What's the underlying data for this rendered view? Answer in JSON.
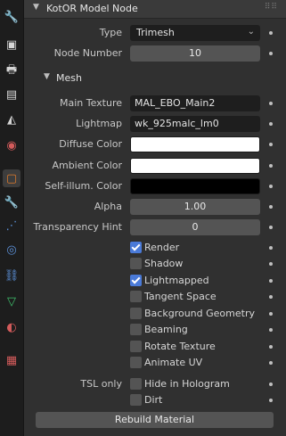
{
  "tabs": [
    {
      "icon": "tool-icon",
      "glyph": "🔧"
    },
    {
      "icon": "render-icon",
      "glyph": "▣"
    },
    {
      "icon": "output-icon",
      "glyph": "🖶"
    },
    {
      "icon": "view-layer-icon",
      "glyph": "▤"
    },
    {
      "icon": "scene-icon",
      "glyph": "◭"
    },
    {
      "icon": "world-icon",
      "glyph": "◉"
    },
    {
      "icon": "object-icon",
      "glyph": "▢"
    },
    {
      "icon": "modifier-icon",
      "glyph": "🔧"
    },
    {
      "icon": "particles-icon",
      "glyph": "⋰"
    },
    {
      "icon": "physics-icon",
      "glyph": "◎"
    },
    {
      "icon": "constraints-icon",
      "glyph": "⛓"
    },
    {
      "icon": "object-data-icon",
      "glyph": "▽"
    },
    {
      "icon": "material-icon",
      "glyph": "◐"
    },
    {
      "icon": "texture-icon",
      "glyph": "▦"
    }
  ],
  "panel": {
    "title": "KotOR Model Node"
  },
  "type": {
    "label": "Type",
    "value": "Trimesh"
  },
  "node_number": {
    "label": "Node Number",
    "value": "10"
  },
  "mesh": {
    "title": "Mesh",
    "main_texture": {
      "label": "Main Texture",
      "value": "MAL_EBO_Main2"
    },
    "lightmap": {
      "label": "Lightmap",
      "value": "wk_925malc_lm0"
    },
    "diffuse": {
      "label": "Diffuse Color",
      "color": "#ffffff"
    },
    "ambient": {
      "label": "Ambient Color",
      "color": "#ffffff"
    },
    "selfillum": {
      "label": "Self-illum. Color",
      "color": "#000000"
    },
    "alpha": {
      "label": "Alpha",
      "value": "1.00"
    },
    "transparency": {
      "label": "Transparency Hint",
      "value": "0"
    },
    "checks": [
      {
        "label": "Render",
        "checked": true
      },
      {
        "label": "Shadow",
        "checked": false
      },
      {
        "label": "Lightmapped",
        "checked": true
      },
      {
        "label": "Tangent Space",
        "checked": false
      },
      {
        "label": "Background Geometry",
        "checked": false
      },
      {
        "label": "Beaming",
        "checked": false
      },
      {
        "label": "Rotate Texture",
        "checked": false
      },
      {
        "label": "Animate UV",
        "checked": false
      }
    ],
    "tsl_label": "TSL only",
    "tsl_checks": [
      {
        "label": "Hide in Hologram",
        "checked": false
      },
      {
        "label": "Dirt",
        "checked": false
      }
    ],
    "rebuild_label": "Rebuild Material"
  }
}
